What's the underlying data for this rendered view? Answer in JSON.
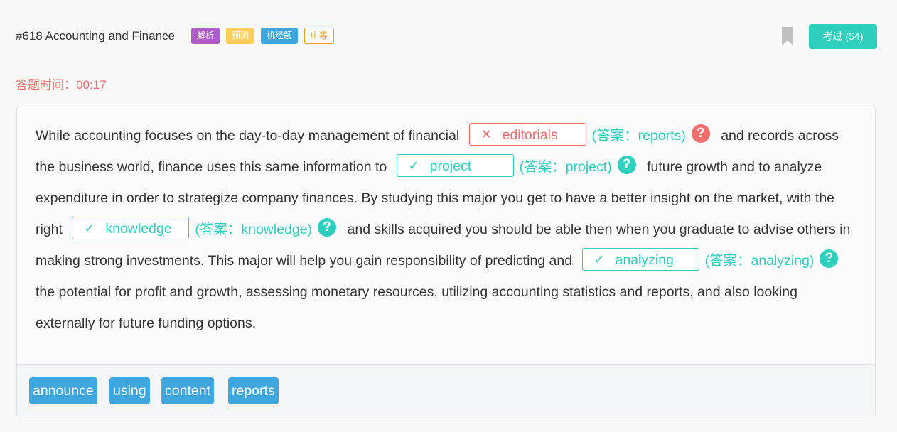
{
  "header": {
    "title": "#618 Accounting and Finance",
    "tags": [
      {
        "label": "解析",
        "color": "#ad5bc6"
      },
      {
        "label": "预测",
        "color": "#ffcf5a"
      },
      {
        "label": "机经题",
        "color": "#3fa7df"
      },
      {
        "label": "中等",
        "color": "#f0a020"
      }
    ],
    "pass_button": "考过 (54)"
  },
  "timer": {
    "label": "答题时间：",
    "value": "00:17"
  },
  "passage": {
    "t1": "While accounting focuses on the day-to-day management of financial",
    "b1": {
      "mark": "✕",
      "value": "editorials",
      "answer": "(答案：reports)",
      "status": "wrong"
    },
    "t2": "and records across the business world, finance uses this same information to",
    "b2": {
      "mark": "✓",
      "value": "project",
      "answer": "(答案：project)",
      "status": "correct"
    },
    "t3": "future growth and to analyze expenditure in order to strategize company finances. By studying this major you get to have a better insight on the market, with the right",
    "b3": {
      "mark": "✓",
      "value": "knowledge",
      "answer": "(答案：knowledge)",
      "status": "correct"
    },
    "t4": "and skills acquired you should be able then when you graduate to advise others in making strong investments. This major will help you gain responsibility of predicting and",
    "b4": {
      "mark": "✓",
      "value": "analyzing",
      "answer": "(答案：analyzing)",
      "status": "correct"
    },
    "t5": "the potential for profit and growth, assessing monetary resources, utilizing accounting statistics and reports, and also looking externally for future funding options.",
    "help": "?"
  },
  "word_bank": [
    "announce",
    "using",
    "content",
    "reports"
  ],
  "colors": {
    "accent": "#2ecfbd",
    "error": "#f06e6e",
    "word": "#3fa7df"
  }
}
